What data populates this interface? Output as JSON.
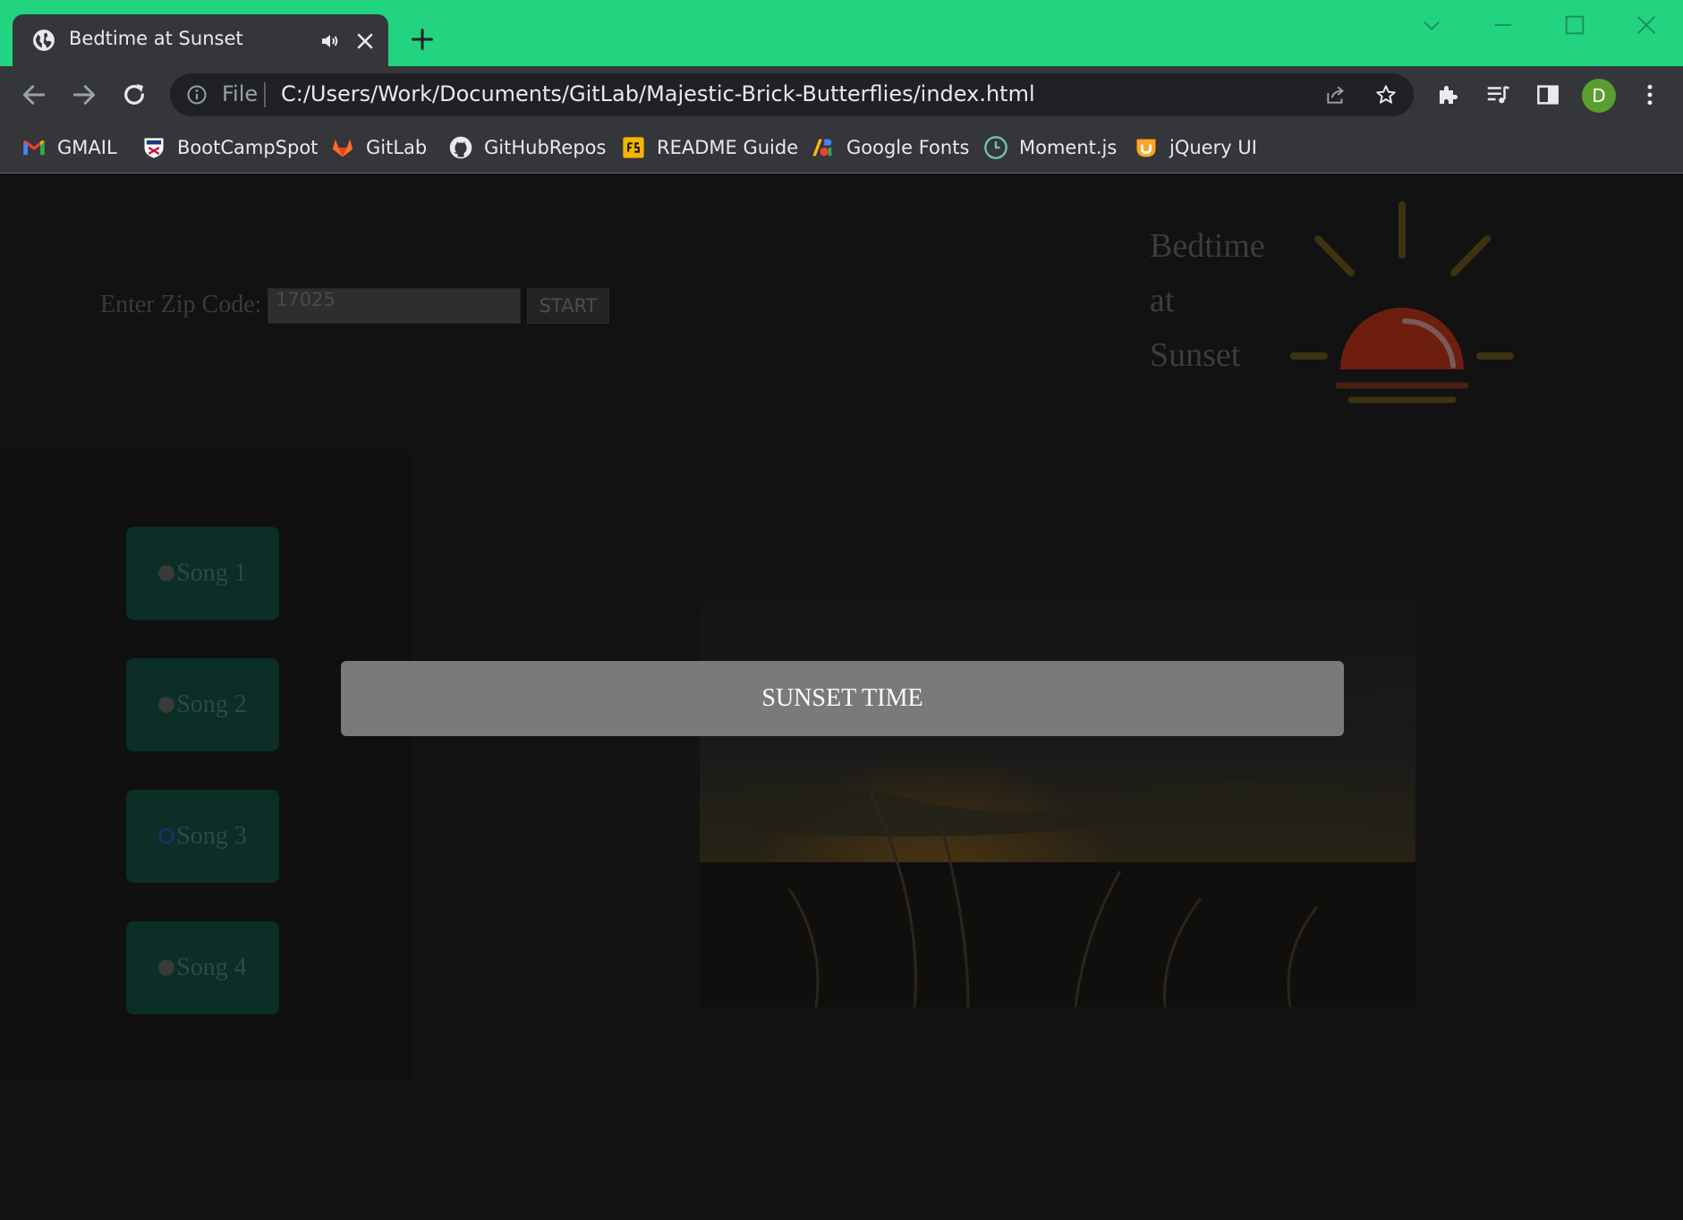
{
  "browser": {
    "tab": {
      "title": "Bedtime at Sunset"
    },
    "address_bar": {
      "scheme_label": "File",
      "url": "C:/Users/Work/Documents/GitLab/Majestic-Brick-Butterflies/index.html"
    },
    "profile_initial": "D",
    "bookmarks": [
      {
        "label": "GMAIL",
        "icon": "gmail-icon"
      },
      {
        "label": "BootCampSpot",
        "icon": "bootcampspot-icon"
      },
      {
        "label": "GitLab",
        "icon": "gitlab-icon"
      },
      {
        "label": "GitHubRepos",
        "icon": "github-icon"
      },
      {
        "label": "README Guide",
        "icon": "readme-guide-icon"
      },
      {
        "label": "Google Fonts",
        "icon": "google-fonts-icon"
      },
      {
        "label": "Moment.js",
        "icon": "momentjs-icon"
      },
      {
        "label": "jQuery UI",
        "icon": "jquery-ui-icon"
      }
    ],
    "colors": {
      "frame": "#22d480",
      "toolbar": "#35363a",
      "omnibox": "#202124"
    }
  },
  "page": {
    "zip": {
      "label": "Enter Zip Code:",
      "value": "17025",
      "button": "START"
    },
    "brand": {
      "line1": "Bedtime",
      "line2": "at",
      "line3": "Sunset"
    },
    "songs": [
      {
        "label": "Song 1",
        "selected": false
      },
      {
        "label": "Song 2",
        "selected": false
      },
      {
        "label": "Song 3",
        "selected": true
      },
      {
        "label": "Song 4",
        "selected": false
      }
    ],
    "modal": {
      "text": "SUNSET TIME"
    },
    "colors": {
      "background": "#121212",
      "song_button": "#0b2e27",
      "modal": "#7a7a7a",
      "logo_sun": "#6e1e0f",
      "logo_rays": "#3d3312"
    }
  }
}
